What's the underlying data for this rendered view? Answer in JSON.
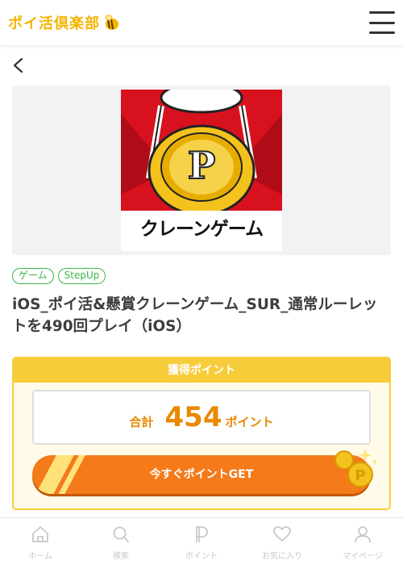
{
  "header": {
    "logo_text": "ポイ活倶楽部",
    "menu_icon": "hamburger-icon"
  },
  "nav": {
    "back_icon": "chevron-left-icon"
  },
  "hero": {
    "image_text": "クレーンゲーム",
    "image_icon": "crane-game-coin-image"
  },
  "tags": [
    "ゲーム",
    "StepUp"
  ],
  "offer": {
    "title": "iOS_ポイ活&懸賞クレーンゲーム_SUR_通常ルーレットを490回プレイ（iOS）"
  },
  "points": {
    "header": "獲得ポイント",
    "total_label": "合計",
    "value": "454",
    "unit": "ポイント",
    "cta_label": "今すぐポイントGET"
  },
  "bottom_nav": [
    {
      "label": "ホーム",
      "icon": "home-icon"
    },
    {
      "label": "検索",
      "icon": "search-icon"
    },
    {
      "label": "ポイント",
      "icon": "points-icon"
    },
    {
      "label": "お気に入り",
      "icon": "heart-icon"
    },
    {
      "label": "マイページ",
      "icon": "user-icon"
    }
  ],
  "colors": {
    "brand_yellow": "#f7cc3a",
    "accent_orange": "#f47a1a",
    "tag_green": "#3bb54a",
    "points_orange": "#e88a00"
  }
}
